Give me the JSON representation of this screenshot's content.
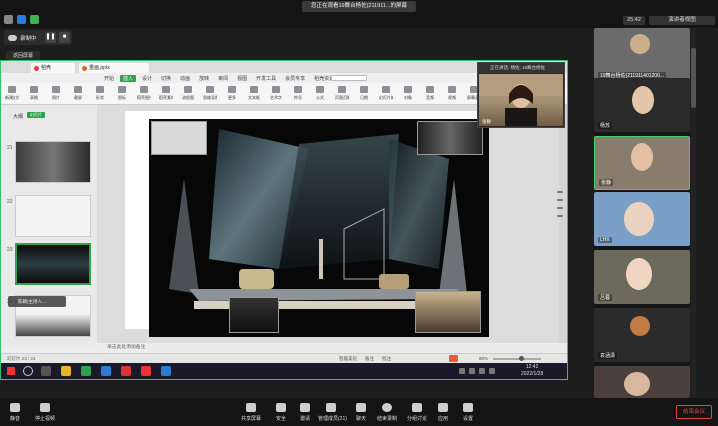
{
  "window": {
    "share_title": "您正在观看19舞台杨佐(211911...的屏幕",
    "clock": "25:42",
    "view_button": "演讲者视图"
  },
  "recording": {
    "status": "录制中",
    "pause_icon": "pause-icon",
    "stop_icon": "stop-icon",
    "return": "返回屏幕"
  },
  "presentation": {
    "tabs": [
      "稻壳",
      "重画.pptx"
    ],
    "menu": [
      "开始",
      "插入",
      "设计",
      "切换",
      "动画",
      "放映",
      "审阅",
      "视图",
      "开发工具",
      "会员专享",
      "稻壳资源"
    ],
    "active_menu": "插入",
    "ribbon": [
      "新建幻灯片",
      "表格",
      "图片",
      "截屏",
      "形状",
      "图标",
      "稻壳图片",
      "稻壳素材",
      "流程图",
      "思维导图",
      "更多",
      "文本框",
      "艺术字",
      "符号",
      "公式",
      "页眉页脚",
      "日期",
      "幻灯片编号",
      "对象",
      "音频",
      "视频",
      "屏幕录制"
    ],
    "thumb_header": "大纲",
    "thumb_tab": "幻灯片",
    "slide_numbers": [
      "21",
      "22",
      "23",
      "24"
    ],
    "notes_placeholder": "单击此处添加备注",
    "status_left": "幻灯片 23 / 24",
    "status_mid": [
      "智能美化",
      "备注",
      "批注"
    ],
    "zoom": "80%"
  },
  "taskbar": {
    "time": "12:42",
    "date": "2022/1/28"
  },
  "speaker_chip": "陈颖(主持人...",
  "float_window": {
    "title": "正在讲话: 杨佐; 19舞台杨佐",
    "name": "张静"
  },
  "participants": [
    {
      "name": "19舞台杨佐(211911401200...",
      "bg": "#6b6b6b"
    },
    {
      "name": "杨苏",
      "bg": "#2a2a2a"
    },
    {
      "name": "张静",
      "bg": "#8a7c6c"
    },
    {
      "name": "LHX",
      "bg": "#7aa0c7"
    },
    {
      "name": "吕蓉",
      "bg": "#6b6a5d"
    },
    {
      "name": "袁涵潇",
      "bg": "#2b2b2b"
    },
    {
      "name": "",
      "bg": "#4a3f3a"
    }
  ],
  "toolbar": {
    "items": [
      "静音",
      "停止视频",
      "共享屏幕",
      "安全",
      "邀请",
      "管理成员(21)",
      "聊天",
      "结束录制",
      "分组讨论",
      "应用",
      "设置"
    ],
    "end": "结束会议"
  }
}
